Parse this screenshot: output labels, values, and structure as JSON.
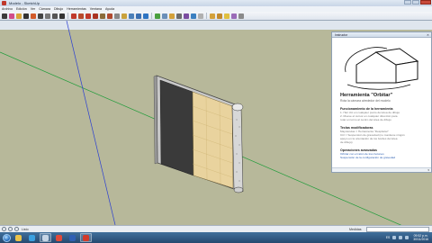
{
  "window": {
    "title": "Modelo - SketchUp"
  },
  "menu": [
    "Archivo",
    "Edición",
    "Ver",
    "Cámara",
    "Dibujo",
    "Herramientas",
    "Ventana",
    "Ayuda"
  ],
  "toolbar": {
    "icons": [
      "select-icon",
      "eraser-icon",
      "paint-icon",
      "line-icon",
      "arc-icon",
      "rectangle-icon",
      "circle-icon",
      "polygon-icon",
      "freehand-icon",
      "move-icon",
      "pushpull-icon",
      "rotate-icon",
      "followme-icon",
      "scale-icon",
      "offset-icon",
      "tape-icon",
      "dimension-icon",
      "protractor-icon",
      "text-icon",
      "axes-icon",
      "orbit-icon",
      "pan-icon",
      "zoom-icon",
      "zoom-window-icon",
      "zoom-extents-icon",
      "previous-view-icon",
      "next-view-icon",
      "components-icon",
      "materials-icon",
      "styles-icon",
      "layers-icon",
      "warehouse-icon"
    ],
    "colors": [
      "#3b3b3b",
      "#d14c8a",
      "#d9a53a",
      "#333333",
      "#d15a2a",
      "#444444",
      "#777777",
      "#555555",
      "#333333",
      "#c0392b",
      "#b84a2d",
      "#c0392b",
      "#aa3322",
      "#8a6b3a",
      "#b04a30",
      "#888888",
      "#c9a23b",
      "#4b7fb8",
      "#3b6fb0",
      "#2e74c2",
      "#4aa03e",
      "#6b8fb8",
      "#d4a13a",
      "#6c6c6c",
      "#7a4ca0",
      "#3a7fc0",
      "#b0b0b0",
      "#d4a13a",
      "#c28a2e",
      "#e0c040",
      "#9a6bb8",
      "#8a8a8a"
    ]
  },
  "instructor": {
    "panel_title": "Instructor",
    "tool_title": "Herramienta \"Orbitar\"",
    "tool_subtitle": "Rota la cámara alrededor del modelo",
    "sec1": {
      "title": "Funcionamiento de la herramienta",
      "lines": [
        "1. Haz clic en cualquier punto del área de dibujo",
        "2. Mueve el cursor en cualquier dirección para",
        "   rotar en torno al centro del área de dibujo"
      ]
    },
    "sec2": {
      "title": "Teclas modificadoras",
      "lines": [
        "Mayúsculas = Herramienta \"Desplazar\"",
        "Ctrl = Suspensión de gravedad (no mantiene ningún",
        "apoyo en la orientación de los bordes del área",
        "de dibujo)"
      ]
    },
    "sec3": {
      "title": "Operaciones avanzadas",
      "links": [
        "Orbitar con el ratón de tres botones",
        "Suspensión de la configuración de gravedad"
      ]
    }
  },
  "statusbar": {
    "text": "Listo",
    "measure_label": "Medidas",
    "measure_value": ""
  },
  "taskbar": {
    "apps": [
      {
        "name": "explorer-app",
        "color": "#e9c24a"
      },
      {
        "name": "media-player-app",
        "color": "#3aa0e0"
      },
      {
        "name": "sketchup-window-app",
        "color": "#c7d6e6"
      },
      {
        "name": "chrome-app",
        "color": "#e04a3a"
      },
      {
        "name": "word-app",
        "color": "#2f5fb3"
      },
      {
        "name": "sketchup-app",
        "color": "#d33b2b"
      }
    ],
    "lang": "ES",
    "time": "09:52 p.m.",
    "date": "30/11/2016"
  },
  "colors": {
    "sky": "#dfe6ee",
    "ground": "#b7b89a",
    "axis_green": "#1f9c3a",
    "axis_blue": "#2b3fd1",
    "door_dark": "#3a3a3a",
    "door_light": "#e9d39e"
  }
}
